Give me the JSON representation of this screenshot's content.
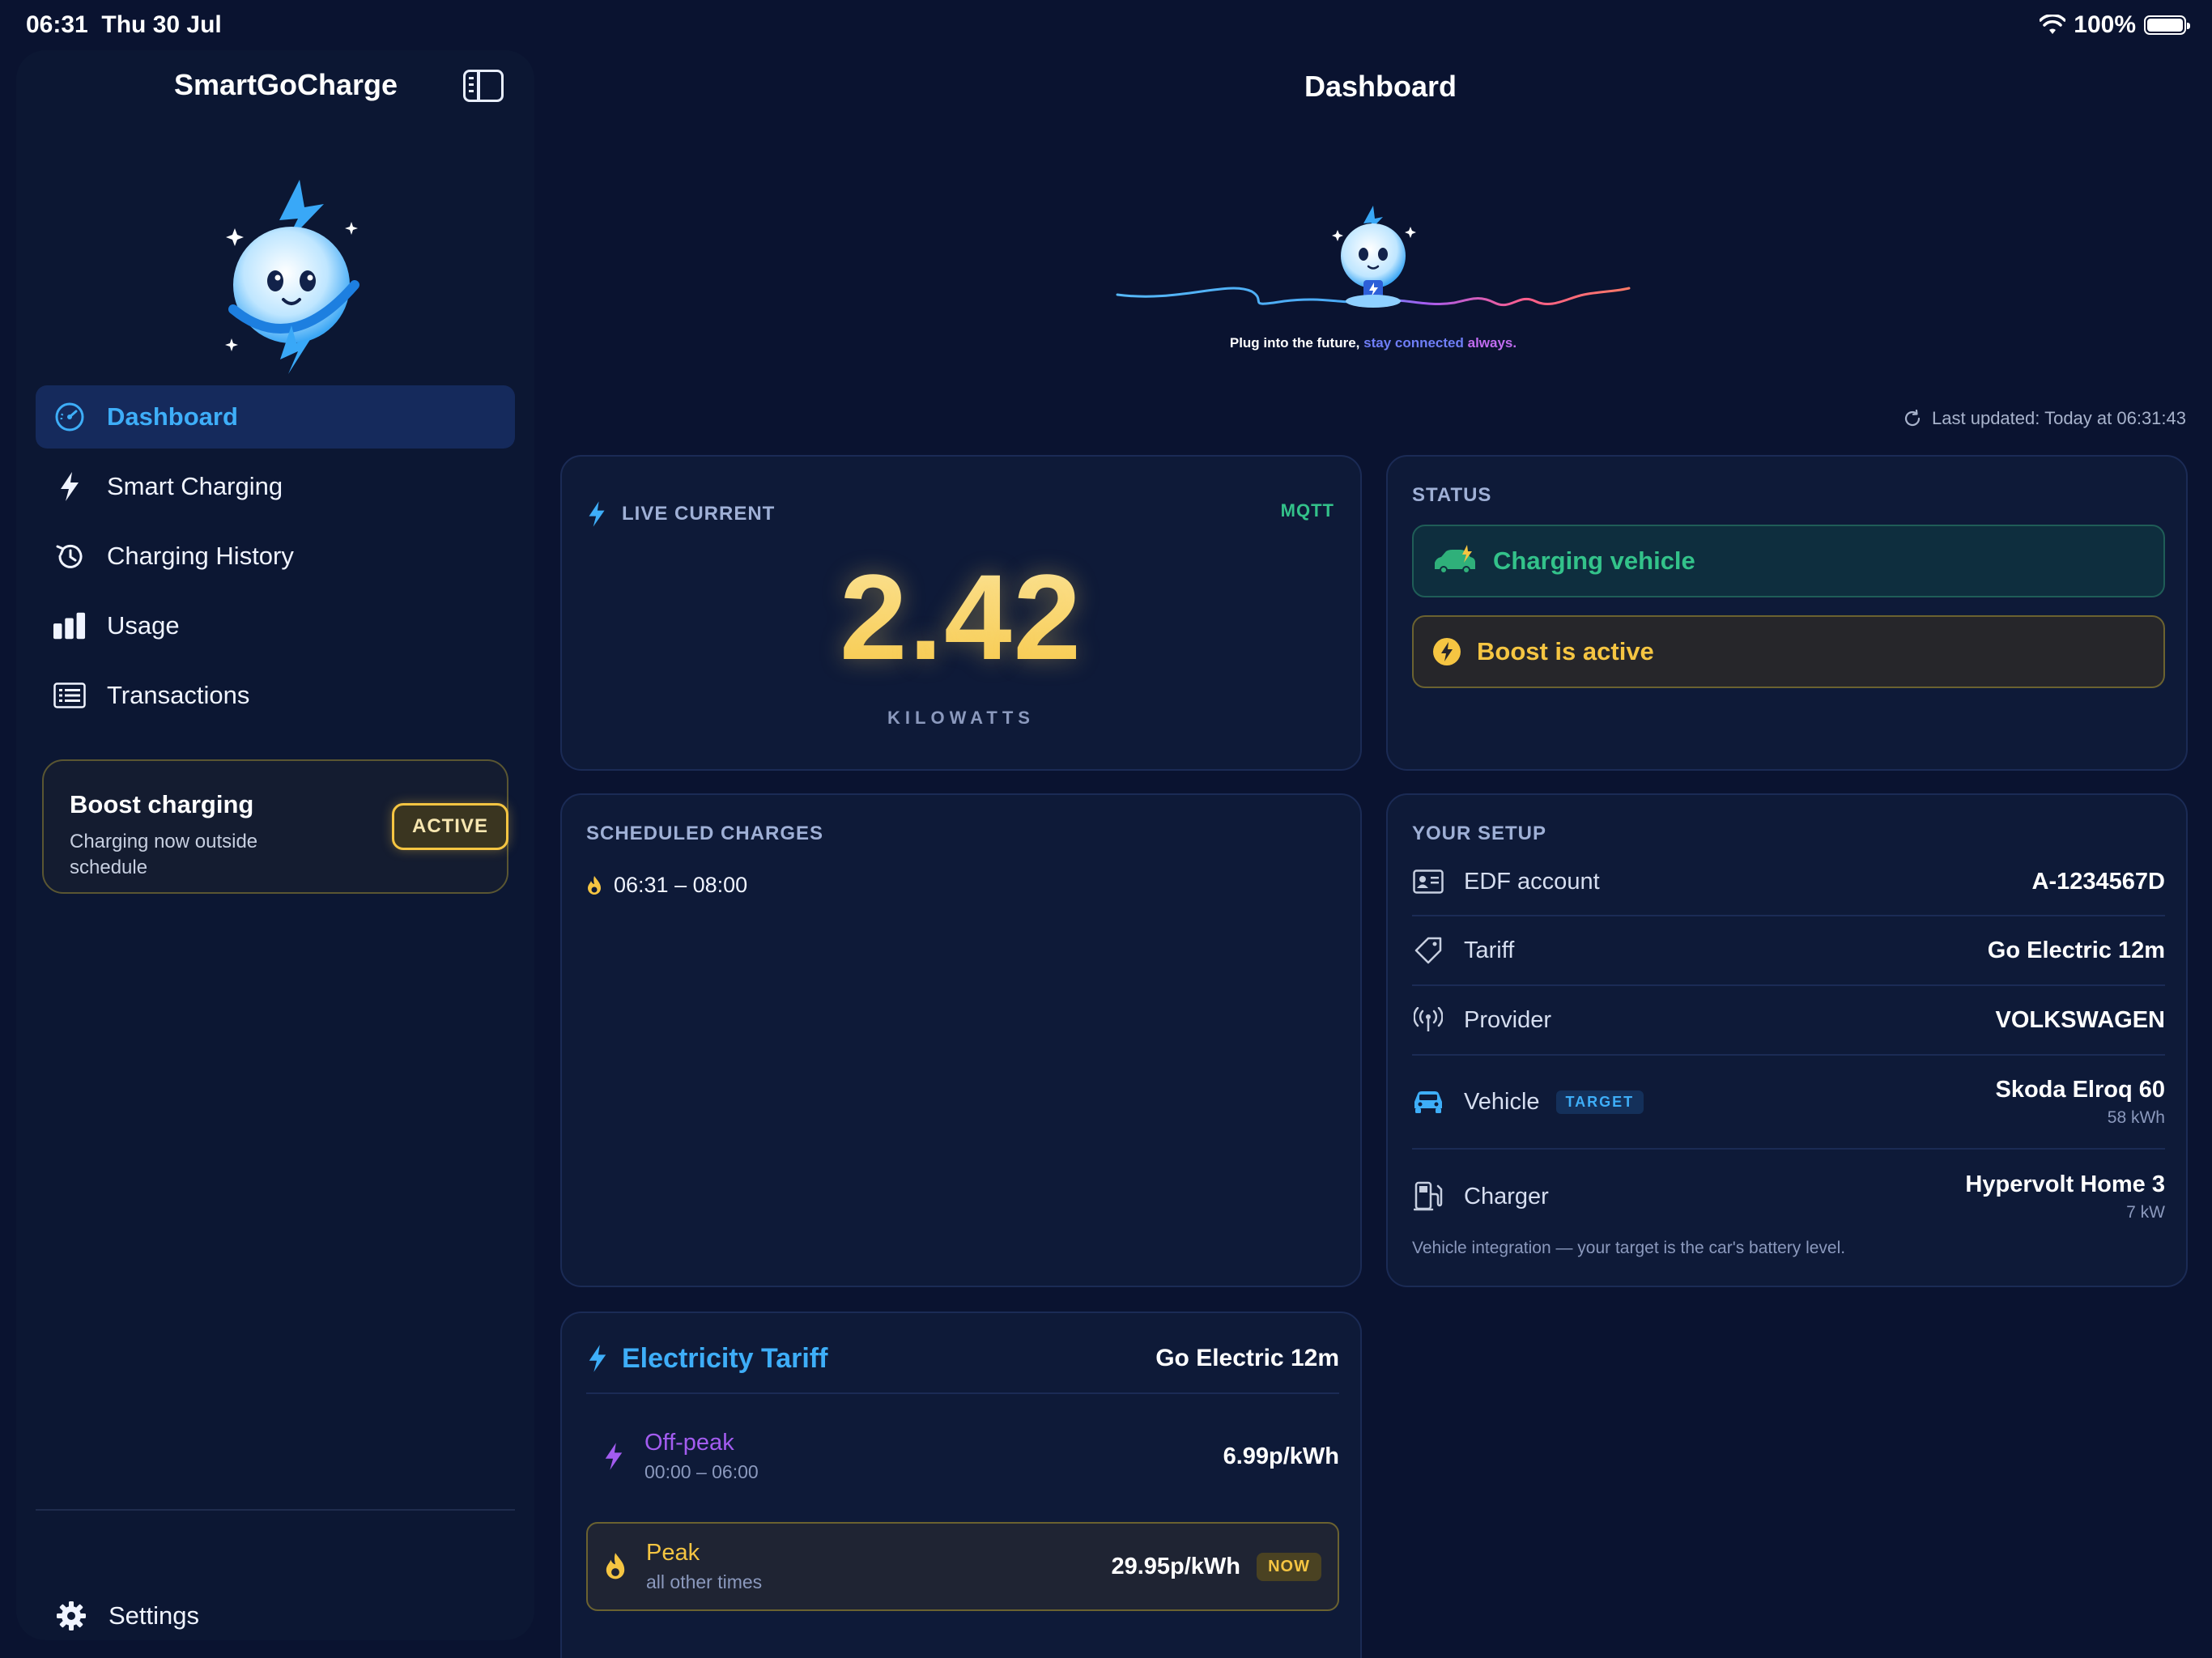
{
  "status_bar": {
    "time": "06:31",
    "date": "Thu 30 Jul",
    "battery": "100%"
  },
  "sidebar": {
    "app_title": "SmartGoCharge",
    "items": [
      {
        "label": "Dashboard",
        "icon": "gauge-icon",
        "active": true
      },
      {
        "label": "Smart Charging",
        "icon": "bolt-icon"
      },
      {
        "label": "Charging History",
        "icon": "history-icon"
      },
      {
        "label": "Usage",
        "icon": "bar-chart-icon"
      },
      {
        "label": "Transactions",
        "icon": "list-icon"
      }
    ],
    "boost": {
      "title": "Boost charging",
      "subtitle": "Charging now outside schedule",
      "badge": "ACTIVE"
    },
    "settings_label": "Settings"
  },
  "main": {
    "title": "Dashboard",
    "hero": {
      "tagline_prefix": "Plug into the future, ",
      "tagline_mid": "stay connected ",
      "tagline_end": "always."
    },
    "last_updated": "Last updated: Today at 06:31:43",
    "live_current": {
      "heading": "LIVE CURRENT",
      "source": "MQTT",
      "value": "2.42",
      "unit": "KILOWATTS"
    },
    "status": {
      "heading": "STATUS",
      "charging": "Charging vehicle",
      "boost": "Boost is active"
    },
    "scheduled": {
      "heading": "SCHEDULED CHARGES",
      "slots": [
        "06:31 – 08:00"
      ]
    },
    "setup": {
      "heading": "YOUR SETUP",
      "rows": [
        {
          "label": "EDF account",
          "value": "A-1234567D",
          "icon": "id-card-icon"
        },
        {
          "label": "Tariff",
          "value": "Go Electric 12m",
          "icon": "tag-icon"
        },
        {
          "label": "Provider",
          "value": "VOLKSWAGEN",
          "icon": "antenna-icon"
        },
        {
          "label": "Vehicle",
          "value": "Skoda Elroq 60",
          "sub": "58 kWh",
          "badge": "TARGET",
          "icon": "car-icon"
        },
        {
          "label": "Charger",
          "value": "Hypervolt Home 3",
          "sub": "7 kW",
          "icon": "ev-charger-icon"
        }
      ],
      "note": "Vehicle integration — your target is the car's battery level."
    },
    "tariff": {
      "title": "Electricity Tariff",
      "plan": "Go Electric 12m",
      "rates": [
        {
          "name": "Off-peak",
          "time": "00:00 – 06:00",
          "price": "6.99p/kWh"
        },
        {
          "name": "Peak",
          "time": "all other times",
          "price": "29.95p/kWh",
          "badge": "NOW"
        }
      ]
    }
  },
  "colors": {
    "accent": "#3eaef8",
    "gold": "#f5c542",
    "green": "#33c28a",
    "purple": "#a35cf0"
  }
}
